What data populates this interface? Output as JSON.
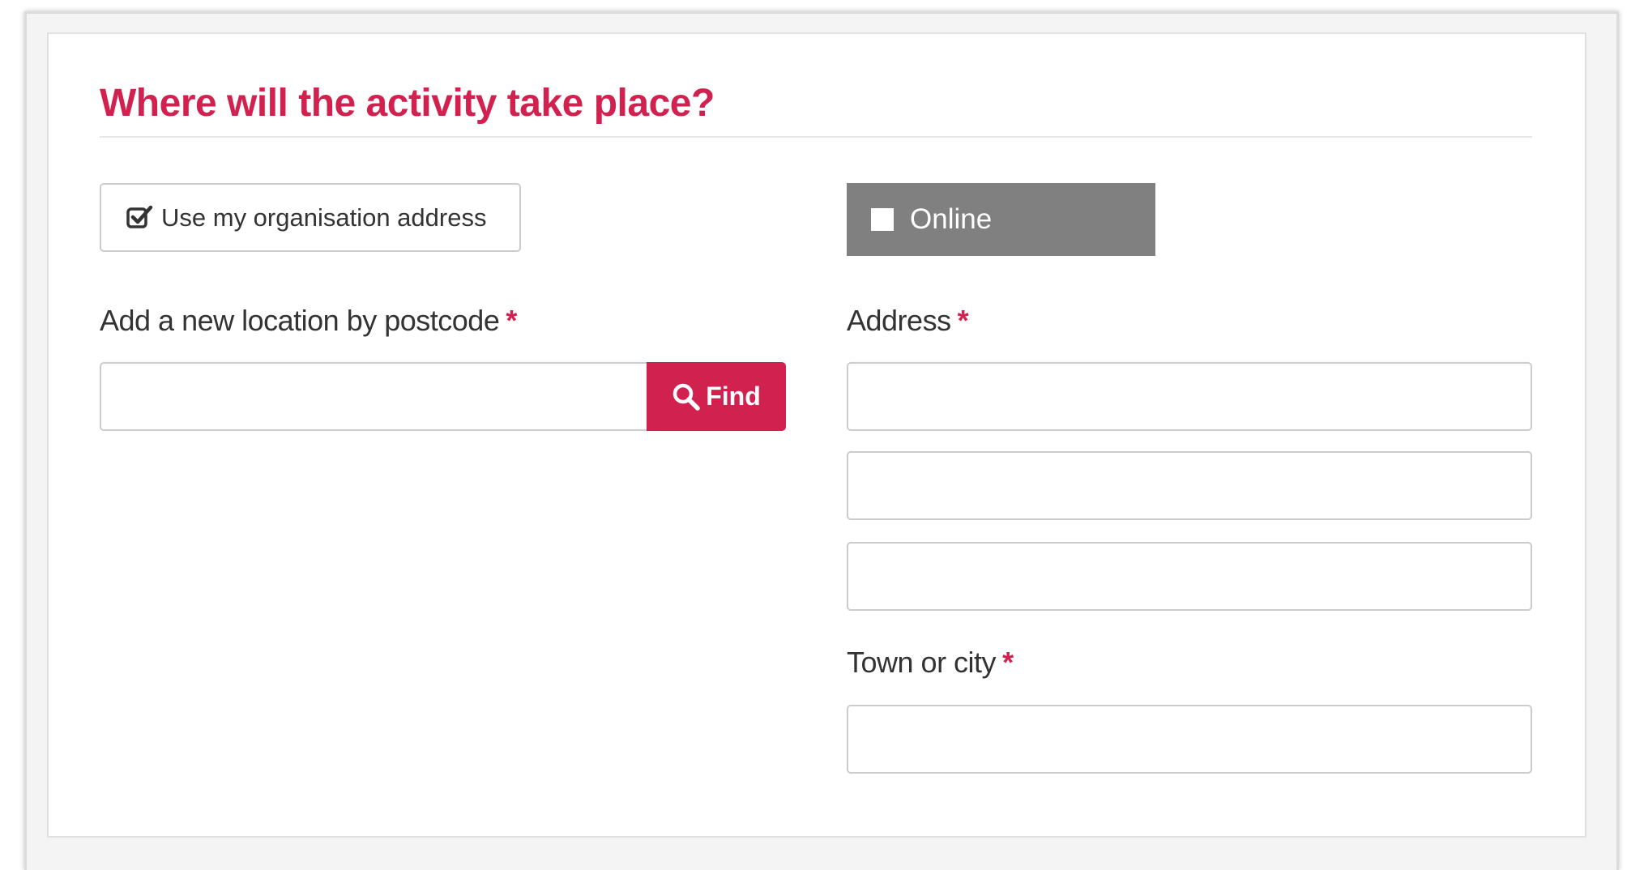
{
  "heading": "Where will the activity take place?",
  "org_button": {
    "label": "Use my organisation address",
    "icon": "checkbox-checked-icon"
  },
  "online_button": {
    "label": "Online",
    "icon": "checkbox-empty-icon"
  },
  "postcode": {
    "label": "Add a new location by postcode",
    "required_marker": "*",
    "value": "",
    "find_label": "Find",
    "find_icon": "search-icon"
  },
  "address": {
    "label": "Address",
    "required_marker": "*",
    "lines": [
      "",
      "",
      ""
    ]
  },
  "town": {
    "label": "Town or city",
    "required_marker": "*",
    "value": ""
  },
  "colors": {
    "accent": "#d1224f",
    "online_bg": "#808080",
    "text": "#333333"
  }
}
